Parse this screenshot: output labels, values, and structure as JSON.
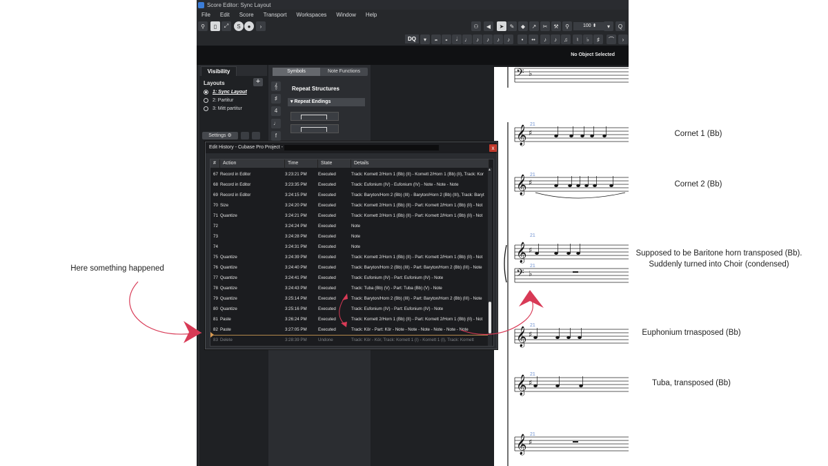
{
  "window": {
    "title": "Score Editor: Sync Layout",
    "menu": [
      "File",
      "Edit",
      "Score",
      "Transport",
      "Workspaces",
      "Window",
      "Help"
    ],
    "zoom": "100",
    "dq_label": "DQ",
    "status": "No Object Selected"
  },
  "left_panel": {
    "tab": "Visibility",
    "section_title": "Layouts",
    "add_label": "+",
    "layouts": [
      {
        "label": "1: Sync Layout",
        "selected": true
      },
      {
        "label": "2: Partitur",
        "selected": false
      },
      {
        "label": "3: Mitt partitur",
        "selected": false
      }
    ],
    "settings_label": "Settings"
  },
  "symbols_panel": {
    "tabs": [
      "Symbols",
      "Note Functions"
    ],
    "section_title": "Repeat Structures",
    "subsection": "Repeat Endings"
  },
  "dialog": {
    "title": "Edit History - Cubase Pro Project - ",
    "close_label": "x",
    "columns": [
      "#",
      "Action",
      "Time",
      "State",
      "Details"
    ],
    "rows": [
      {
        "num": "67",
        "action": "Record in Editor",
        "time": "3:23:21 PM",
        "state": "Executed",
        "details": "Track: Kornett 2/Horn 1 (Bb) (II) - Kornett 2/Horn 1 (Bb) (II), Track: Kor"
      },
      {
        "num": "68",
        "action": "Record in Editor",
        "time": "3:23:35 PM",
        "state": "Executed",
        "details": "Track: Eufonium (IV) - Eufonium (IV) - Note - Note - Note"
      },
      {
        "num": "69",
        "action": "Record in Editor",
        "time": "3:24:15 PM",
        "state": "Executed",
        "details": "Track: Baryton/Horn 2 (Bb) (III) - Baryton/Horn 2 (Bb) (III), Track: Baryt"
      },
      {
        "num": "70",
        "action": "Size",
        "time": "3:24:20 PM",
        "state": "Executed",
        "details": "Track: Kornett 2/Horn 1 (Bb) (II) - Part: Kornett 2/Horn 1 (Bb) (II) - Not"
      },
      {
        "num": "71",
        "action": "Quantize",
        "time": "3:24:21 PM",
        "state": "Executed",
        "details": "Track: Kornett 2/Horn 1 (Bb) (II) - Part: Kornett 2/Horn 1 (Bb) (II) - Not"
      },
      {
        "num": "72",
        "action": "",
        "time": "3:24:24 PM",
        "state": "Executed",
        "details": "Note"
      },
      {
        "num": "73",
        "action": "",
        "time": "3:24:28 PM",
        "state": "Executed",
        "details": "Note"
      },
      {
        "num": "74",
        "action": "",
        "time": "3:24:31 PM",
        "state": "Executed",
        "details": "Note"
      },
      {
        "num": "75",
        "action": "Quantize",
        "time": "3:24:39 PM",
        "state": "Executed",
        "details": "Track: Kornett 2/Horn 1 (Bb) (II) - Part: Kornett 2/Horn 1 (Bb) (II) - Not"
      },
      {
        "num": "76",
        "action": "Quantize",
        "time": "3:24:40 PM",
        "state": "Executed",
        "details": "Track: Baryton/Horn 2 (Bb) (III) - Part: Baryton/Horn 2 (Bb) (III) - Note"
      },
      {
        "num": "77",
        "action": "Quantize",
        "time": "3:24:41 PM",
        "state": "Executed",
        "details": "Track: Eufonium (IV) - Part: Eufonium (IV) - Note"
      },
      {
        "num": "78",
        "action": "Quantize",
        "time": "3:24:43 PM",
        "state": "Executed",
        "details": "Track: Tuba (Bb) (V) - Part: Tuba (Bb) (V) - Note"
      },
      {
        "num": "79",
        "action": "Quantize",
        "time": "3:25:14 PM",
        "state": "Executed",
        "details": "Track: Baryton/Horn 2 (Bb) (III) - Part: Baryton/Horn 2 (Bb) (III) - Note"
      },
      {
        "num": "80",
        "action": "Quantize",
        "time": "3:25:16 PM",
        "state": "Executed",
        "details": "Track: Eufonium (IV) - Part: Eufonium (IV) - Note"
      },
      {
        "num": "81",
        "action": "Paste",
        "time": "3:26:24 PM",
        "state": "Executed",
        "details": "Track: Kornett 2/Horn 1 (Bb) (II) - Part: Kornett 2/Horn 1 (Bb) (II) - Not"
      },
      {
        "num": "82",
        "action": "Paste",
        "time": "3:27:05 PM",
        "state": "Executed",
        "details": "Track: Kör - Part: Kör - Note - Note - Note - Note - Note - Note"
      },
      {
        "num": "83",
        "action": "Delete",
        "time": "3:28:39 PM",
        "state": "Undone",
        "details": "Track: Kör - Kör, Track: Kornett 1 (I) - Kornett 1 (I), Track: Kornett"
      }
    ]
  },
  "score": {
    "measure_number": "21"
  },
  "annotations": {
    "left_note": "Here something happened",
    "cornet1": "Cornet 1 (Bb)",
    "cornet2": "Cornet 2 (Bb)",
    "baritone_line1": "Supposed to be Baritone horn transposed (Bb).",
    "baritone_line2": "Suddenly turned into Choir (condensed)",
    "euphonium": "Euphonium trnasposed (Bb)",
    "tuba": "Tuba, transposed (Bb)"
  },
  "colors": {
    "arrow": "#d83a56",
    "marker": "#d89a52",
    "measure_number": "#6b8fd1"
  }
}
